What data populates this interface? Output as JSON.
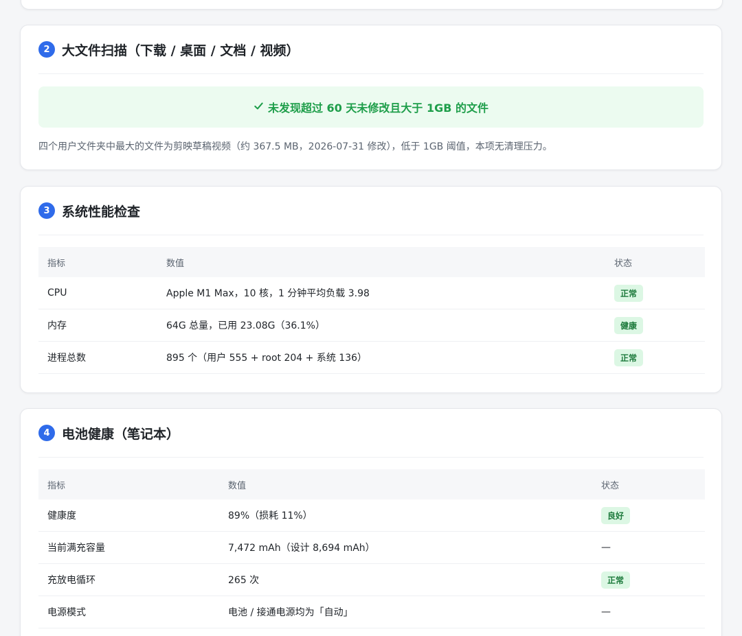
{
  "sections": [
    {
      "number": "2",
      "title": "大文件扫描（下载 / 桌面 / 文档 / 视频）",
      "banner": "未发现超过 60 天未修改且大于 1GB 的文件",
      "banner_icon": "check-icon",
      "note": "四个用户文件夹中最大的文件为剪映草稿视频（约 367.5 MB，2026-07-31 修改），低于 1GB 阈值，本项无清理压力。"
    },
    {
      "number": "3",
      "title": "系统性能检查",
      "columns": [
        "指标",
        "数值",
        "状态"
      ],
      "rows": [
        {
          "metric": "CPU",
          "value": "Apple M1 Max，10 核，1 分钟平均负载 3.98",
          "status": "正常"
        },
        {
          "metric": "内存",
          "value": "64G 总量，已用 23.08G（36.1%）",
          "status": "健康"
        },
        {
          "metric": "进程总数",
          "value": "895 个（用户 555 + root 204 + 系统 136）",
          "status": "正常"
        }
      ]
    },
    {
      "number": "4",
      "title": "电池健康（笔记本）",
      "columns": [
        "指标",
        "数值",
        "状态"
      ],
      "rows": [
        {
          "metric": "健康度",
          "value": "89%（损耗 11%）",
          "status": "良好"
        },
        {
          "metric": "当前满充容量",
          "value": "7,472 mAh（设计 8,694 mAh）",
          "status": "—"
        },
        {
          "metric": "充放电循环",
          "value": "265 次",
          "status": "正常"
        },
        {
          "metric": "电源模式",
          "value": "电池 / 接通电源均为「自动」",
          "status": "—"
        }
      ]
    }
  ],
  "colors": {
    "accent": "#2f6bea",
    "success_text": "#1e9e4a",
    "success_bg": "#ecfbf0",
    "badge_bg": "#dcf7e4",
    "badge_text": "#1d7a3c"
  }
}
